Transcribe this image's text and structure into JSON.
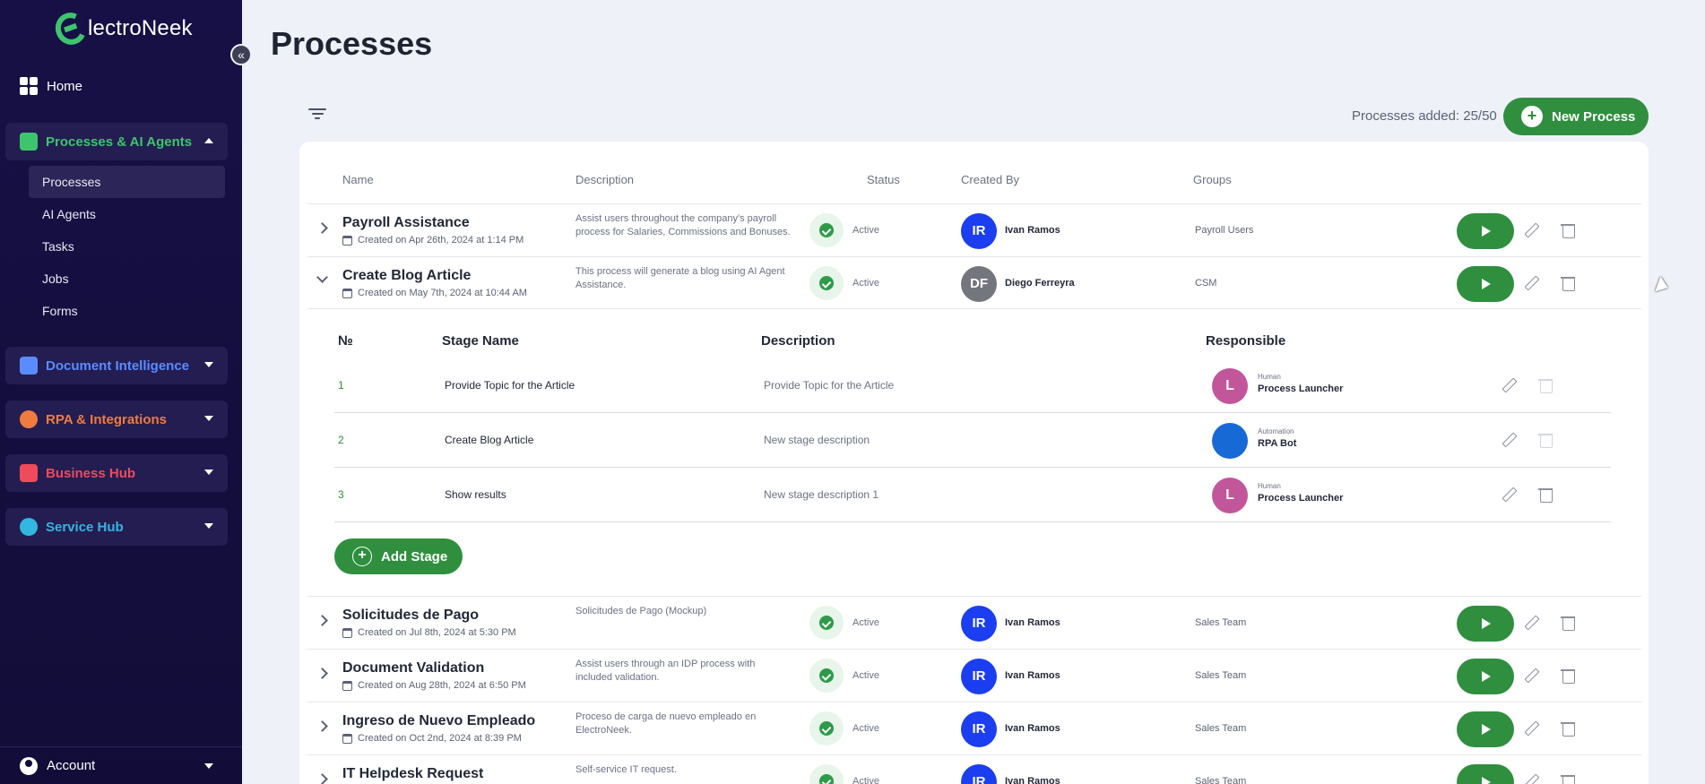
{
  "sidebar": {
    "logo_text": "lectroNeek",
    "home_label": "Home",
    "sections": [
      {
        "label": "Processes & AI Agents",
        "color": "#3fc46e"
      },
      {
        "label": "Document Intelligence",
        "color": "#5b8cff"
      },
      {
        "label": "RPA & Integrations",
        "color": "#f07b3f"
      },
      {
        "label": "Business Hub",
        "color": "#ef4b5a"
      },
      {
        "label": "Service Hub",
        "color": "#33b6e0"
      }
    ],
    "sub_items": [
      "Processes",
      "AI Agents",
      "Tasks",
      "Jobs",
      "Forms"
    ],
    "account_label": "Account"
  },
  "main": {
    "title": "Processes",
    "count_text": "Processes added: 25/50",
    "new_process_label": "New Process",
    "columns": {
      "name": "Name",
      "description": "Description",
      "status": "Status",
      "created_by": "Created By",
      "groups": "Groups"
    },
    "processes": [
      {
        "name": "Payroll Assistance",
        "created": "Created on Apr 26th, 2024 at 1:14 PM",
        "description": "Assist users throughout the company's payroll process for Salaries, Commissions and Bonuses.",
        "status": "Active",
        "initials": "IR",
        "creator": "Ivan Ramos",
        "group": "Payroll Users"
      },
      {
        "name": "Create Blog Article",
        "created": "Created on May 7th, 2024 at 10:44 AM",
        "description": "This process will generate a blog using AI Agent Assistance.",
        "status": "Active",
        "initials": "DF",
        "creator": "Diego Ferreyra",
        "group": "CSM"
      },
      {
        "name": "Solicitudes de Pago",
        "created": "Created on Jul 8th, 2024 at 5:30 PM",
        "description": "Solicitudes de Pago (Mockup)",
        "status": "Active",
        "initials": "IR",
        "creator": "Ivan Ramos",
        "group": "Sales Team"
      },
      {
        "name": "Document Validation",
        "created": "Created on Aug 28th, 2024 at 6:50 PM",
        "description": "Assist users through an IDP process with included validation.",
        "status": "Active",
        "initials": "IR",
        "creator": "Ivan Ramos",
        "group": "Sales Team"
      },
      {
        "name": "Ingreso de Nuevo Empleado",
        "created": "Created on Oct 2nd, 2024 at 8:39 PM",
        "description": "Proceso de carga de nuevo empleado en ElectroNeek.",
        "status": "Active",
        "initials": "IR",
        "creator": "Ivan Ramos",
        "group": "Sales Team"
      },
      {
        "name": "IT Helpdesk Request",
        "created": "",
        "description": "Self-service IT request.",
        "status": "Active",
        "initials": "IR",
        "creator": "Ivan Ramos",
        "group": "Sales Team"
      }
    ],
    "stages": {
      "columns": {
        "no": "№",
        "name": "Stage Name",
        "description": "Description",
        "responsible": "Responsible"
      },
      "items": [
        {
          "no": "1",
          "name": "Provide Topic for the Article",
          "description": "Provide Topic for the Article",
          "initial": "L",
          "role": "Human",
          "responsible": "Process Launcher"
        },
        {
          "no": "2",
          "name": "Create Blog Article",
          "description": "New stage description",
          "initial": "",
          "role": "Automation",
          "responsible": "RPA Bot"
        },
        {
          "no": "3",
          "name": "Show results",
          "description": "New stage description 1",
          "initial": "L",
          "role": "Human",
          "responsible": "Process Launcher"
        }
      ],
      "add_label": "Add Stage"
    }
  }
}
